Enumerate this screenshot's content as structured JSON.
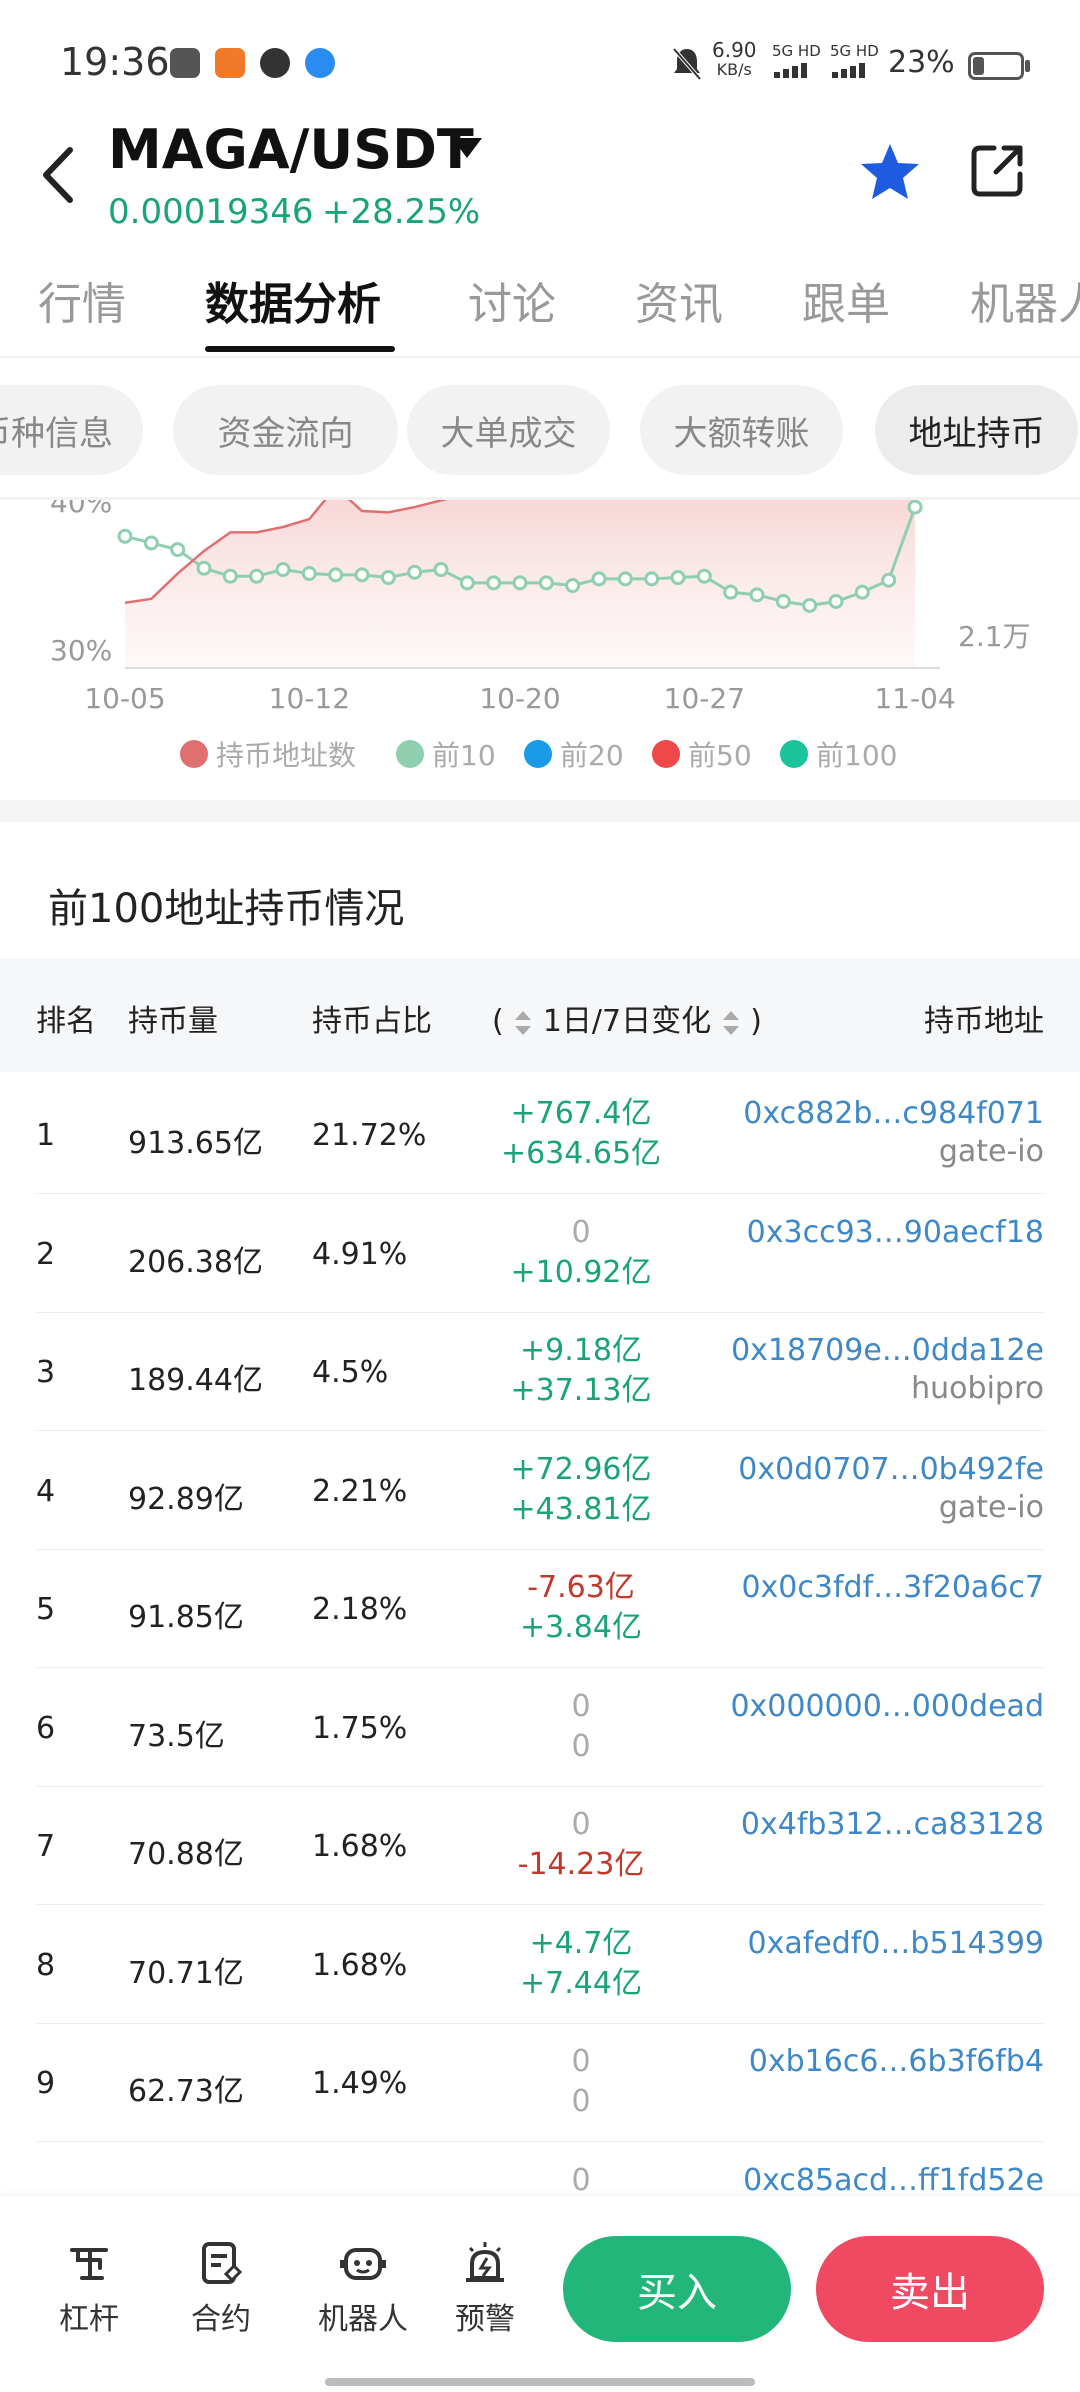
{
  "status": {
    "time": "19:36",
    "net_speed_top": "6.90",
    "net_speed_unit": "KB/s",
    "sim1": "5G HD",
    "sim2": "5G HD",
    "battery": "23%",
    "battery_level": 0.23
  },
  "header": {
    "pair": "MAGA/USDT",
    "price": "0.00019346",
    "change": "+28.25%"
  },
  "tabs": [
    "行情",
    "数据分析",
    "讨论",
    "资讯",
    "跟单",
    "机器人"
  ],
  "active_tab": 1,
  "chips": [
    "币种信息",
    "资金流向",
    "大单成交",
    "大额转账",
    "地址持币"
  ],
  "active_chip": 4,
  "chart_data": {
    "type": "line",
    "x": [
      "10-05",
      "10-06",
      "10-07",
      "10-08",
      "10-09",
      "10-10",
      "10-11",
      "10-12",
      "10-13",
      "10-14",
      "10-15",
      "10-16",
      "10-17",
      "10-18",
      "10-19",
      "10-20",
      "10-21",
      "10-22",
      "10-23",
      "10-24",
      "10-25",
      "10-26",
      "10-27",
      "10-28",
      "10-29",
      "10-30",
      "10-31",
      "11-01",
      "11-02",
      "11-03",
      "11-04"
    ],
    "x_ticks": [
      "10-05",
      "10-12",
      "10-20",
      "10-27",
      "11-04"
    ],
    "y_left_ticks": [
      "40%",
      "30%"
    ],
    "y_right_ticks": [
      "2.1万"
    ],
    "series": [
      {
        "name": "前10",
        "color": "#8fcfb0",
        "values": [
          38.3,
          37.8,
          37.3,
          35.9,
          35.3,
          35.3,
          35.8,
          35.5,
          35.4,
          35.4,
          35.2,
          35.6,
          35.8,
          34.8,
          34.8,
          34.8,
          34.8,
          34.6,
          35.1,
          35.1,
          35.1,
          35.2,
          35.3,
          34.1,
          33.9,
          33.4,
          33.1,
          33.4,
          34.1,
          35.0,
          40.5
        ]
      },
      {
        "name": "持币地址数",
        "color": "#e07070",
        "values": [
          33.3,
          33.6,
          35.5,
          37.2,
          38.6,
          38.6,
          39.0,
          39.6,
          42.0,
          40.2,
          40.1,
          40.5,
          41.0,
          41.5,
          42.0,
          42.0,
          42.0,
          42.0,
          42.0,
          42.0,
          42.0,
          42.0,
          42.0,
          42.0,
          42.0,
          42.0,
          42.0,
          42.0,
          42.0,
          42.0,
          42.0
        ]
      }
    ],
    "ylim": [
      29,
      41
    ]
  },
  "legend": [
    {
      "label": "持币地址数",
      "color": "#e07070"
    },
    {
      "label": "前10",
      "color": "#8fcfb0"
    },
    {
      "label": "前20",
      "color": "#1a9be8"
    },
    {
      "label": "前50",
      "color": "#ef4848"
    },
    {
      "label": "前100",
      "color": "#1bc49a"
    }
  ],
  "holders": {
    "title": "前100地址持币情况",
    "headers": {
      "rank": "排名",
      "amount": "持币量",
      "ratio": "持币占比",
      "open_paren": "(",
      "change": "1日/7日变化",
      "close_paren": ")",
      "address": "持币地址"
    },
    "rows": [
      {
        "rank": "1",
        "amount": "913.65亿",
        "ratio": "21.72%",
        "d1": "+767.4亿",
        "d1_sign": "pos",
        "d7": "+634.65亿",
        "d7_sign": "pos",
        "address": "0xc882b…c984f071",
        "tag": "gate-io"
      },
      {
        "rank": "2",
        "amount": "206.38亿",
        "ratio": "4.91%",
        "d1": "0",
        "d1_sign": "zero",
        "d7": "+10.92亿",
        "d7_sign": "pos",
        "address": "0x3cc93…90aecf18",
        "tag": ""
      },
      {
        "rank": "3",
        "amount": "189.44亿",
        "ratio": "4.5%",
        "d1": "+9.18亿",
        "d1_sign": "pos",
        "d7": "+37.13亿",
        "d7_sign": "pos",
        "address": "0x18709e…0dda12e",
        "tag": "huobipro"
      },
      {
        "rank": "4",
        "amount": "92.89亿",
        "ratio": "2.21%",
        "d1": "+72.96亿",
        "d1_sign": "pos",
        "d7": "+43.81亿",
        "d7_sign": "pos",
        "address": "0x0d0707…0b492fe",
        "tag": "gate-io"
      },
      {
        "rank": "5",
        "amount": "91.85亿",
        "ratio": "2.18%",
        "d1": "-7.63亿",
        "d1_sign": "neg",
        "d7": "+3.84亿",
        "d7_sign": "pos",
        "address": "0x0c3fdf…3f20a6c7",
        "tag": ""
      },
      {
        "rank": "6",
        "amount": "73.5亿",
        "ratio": "1.75%",
        "d1": "0",
        "d1_sign": "zero",
        "d7": "0",
        "d7_sign": "zero",
        "address": "0x000000…000dead",
        "tag": ""
      },
      {
        "rank": "7",
        "amount": "70.88亿",
        "ratio": "1.68%",
        "d1": "0",
        "d1_sign": "zero",
        "d7": "-14.23亿",
        "d7_sign": "neg",
        "address": "0x4fb312…ca83128",
        "tag": ""
      },
      {
        "rank": "8",
        "amount": "70.71亿",
        "ratio": "1.68%",
        "d1": "+4.7亿",
        "d1_sign": "pos",
        "d7": "+7.44亿",
        "d7_sign": "pos",
        "address": "0xafedf0…b514399",
        "tag": ""
      },
      {
        "rank": "9",
        "amount": "62.73亿",
        "ratio": "1.49%",
        "d1": "0",
        "d1_sign": "zero",
        "d7": "0",
        "d7_sign": "zero",
        "address": "0xb16c6…6b3f6fb4",
        "tag": ""
      },
      {
        "rank": "",
        "amount": "",
        "ratio": "",
        "d1": "0",
        "d1_sign": "zero",
        "d7": "",
        "d7_sign": "zero",
        "address": "0xc85acd…ff1fd52e",
        "tag": ""
      }
    ]
  },
  "bottom": {
    "leverage": "杠杆",
    "contract": "合约",
    "robot": "机器人",
    "alert": "预警",
    "buy": "买入",
    "sell": "卖出"
  }
}
